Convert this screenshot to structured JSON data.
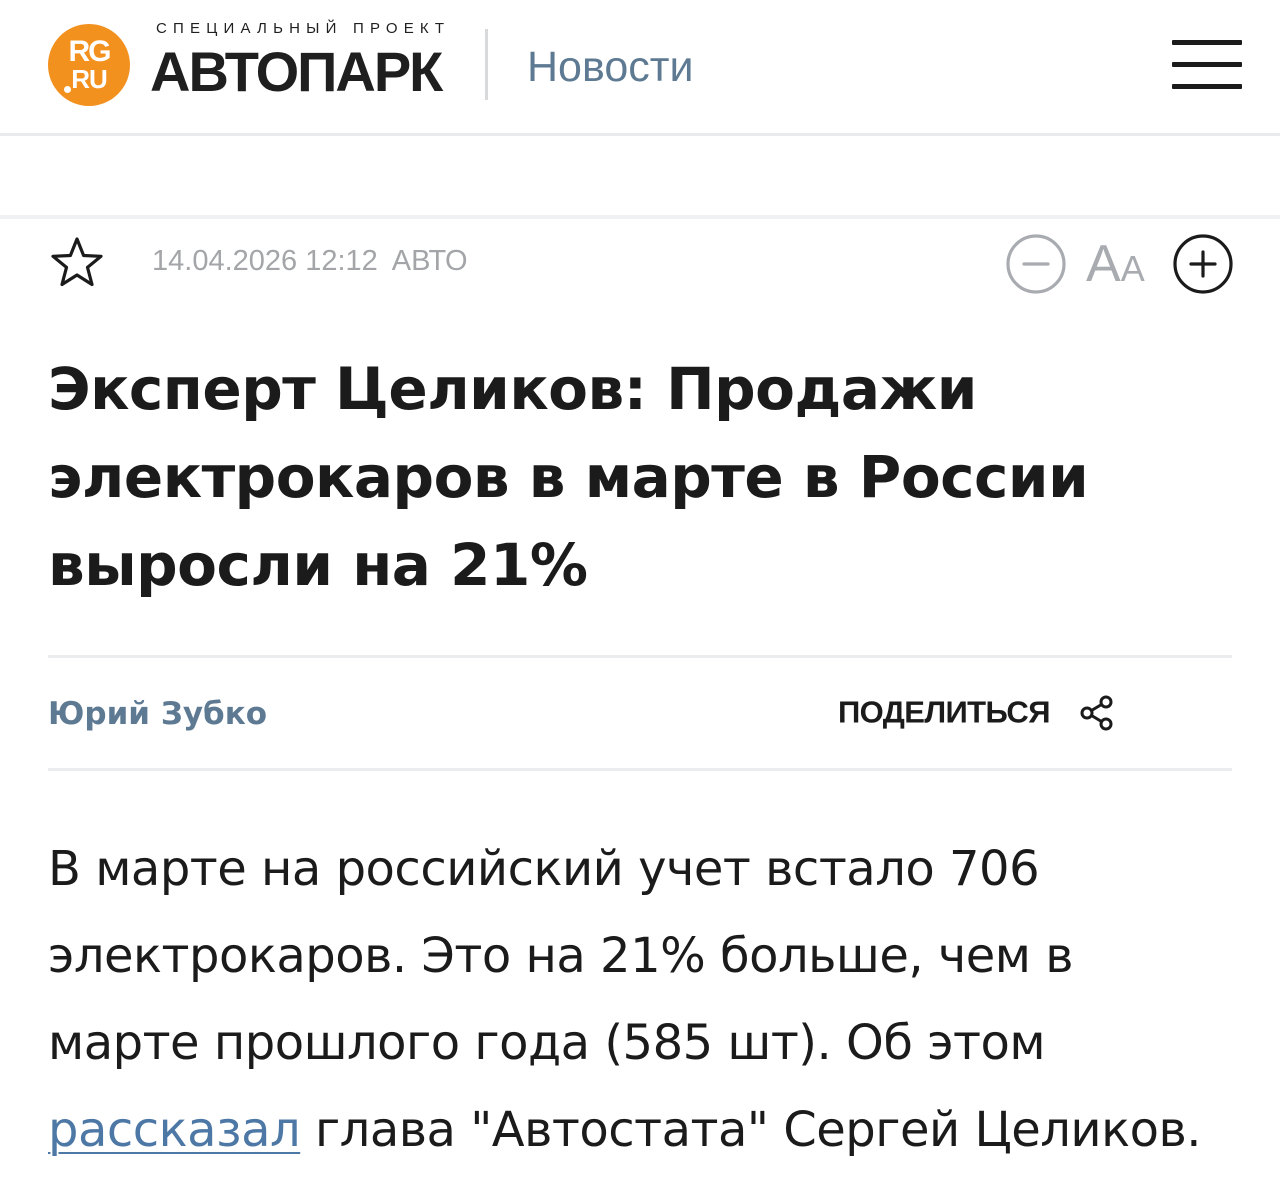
{
  "header": {
    "logo": {
      "line1": "RG",
      "line2": "RU"
    },
    "project_caption": "СПЕЦИАЛЬНЫЙ ПРОЕКТ",
    "project_name": "АВТОПАРК",
    "section_link": "Новости",
    "menu_icon": "hamburger-menu-icon",
    "brand_color": "#f3911f",
    "section_color": "#5e7a93"
  },
  "article": {
    "bookmark_icon": "star-outline-icon",
    "datetime": "14.04.2026 12:12",
    "rubric": "АВТО",
    "font_controls": {
      "decrease_icon": "minus-circle-icon",
      "label_big": "А",
      "label_small": "А",
      "increase_icon": "plus-circle-icon"
    },
    "title": "Эксперт Целиков: Продажи электрокаров в марте в России выросли на 21%",
    "author": "Юрий Зубко",
    "share": {
      "label": "ПОДЕЛИТЬСЯ",
      "icon": "share-icon"
    },
    "lead": {
      "part1": "В марте на российский учет встало 706 электрокаров. Это на 21% больше, чем в марте прошлого года (585 шт). Об этом ",
      "link_text": "рассказал",
      "part2": " глава \"Автостата\" Сергей Целиков."
    },
    "link_color": "#4d78a6"
  }
}
